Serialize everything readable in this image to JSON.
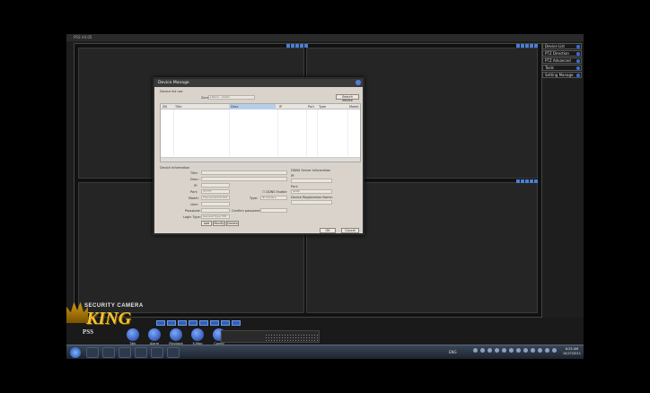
{
  "app": {
    "title": "PSS  V4.05"
  },
  "right_panel": {
    "items": [
      {
        "label": "Device List"
      },
      {
        "label": "PTZ Direction"
      },
      {
        "label": "PTZ Advanced"
      },
      {
        "label": "Tools"
      },
      {
        "label": "Setting Manage"
      }
    ]
  },
  "dialog": {
    "title": "Device Manage",
    "device_list_label": "Device list use",
    "zone_label": "Zone",
    "zone_value": "Labour - lisbon",
    "search_button": "Search device",
    "columns": [
      "ZN",
      "Title",
      "Desc",
      "IP",
      "Port",
      "Type",
      "Model"
    ],
    "device_info_label": "Device Information",
    "fields": {
      "title_label": "Title:",
      "desc_label": "Desc:",
      "ip_label": "IP:",
      "port_label": "Port:",
      "port_value": "37777",
      "model_label": "Model:",
      "model_value": "The second-to the",
      "user_label": "User:",
      "password_label": "Password:",
      "confirm_password_label": "Confirm password:",
      "login_type_label": "Login Type:",
      "login_type_value": "General Type TCP",
      "ddns_label": "DDNS Enable",
      "type_label": "Type:",
      "type_value": "IP Camera"
    },
    "ddns": {
      "section_label": "DDNS Server Information",
      "ip_label": "IP:",
      "port_label": "Port:",
      "port_value": "9200",
      "reg_name_label": "Device Registration Name:"
    },
    "buttons": {
      "add": "Add",
      "modify": "Modify",
      "delete": "Delete",
      "ok": "OK",
      "cancel": "Cancel"
    }
  },
  "tools": [
    {
      "label": "Talk",
      "icon": "talk-icon"
    },
    {
      "label": "Alarm",
      "icon": "alarm-icon"
    },
    {
      "label": "Playback",
      "icon": "playback-icon"
    },
    {
      "label": "E-Map",
      "icon": "emap-icon"
    },
    {
      "label": "Config",
      "icon": "config-icon"
    }
  ],
  "logo": {
    "line1": "SECURITY CAMERA",
    "line2": "KING",
    "line3": "PSS"
  },
  "taskbar": {
    "lang": "ENG",
    "time": "6:25 AM",
    "date": "10/27/2011"
  }
}
